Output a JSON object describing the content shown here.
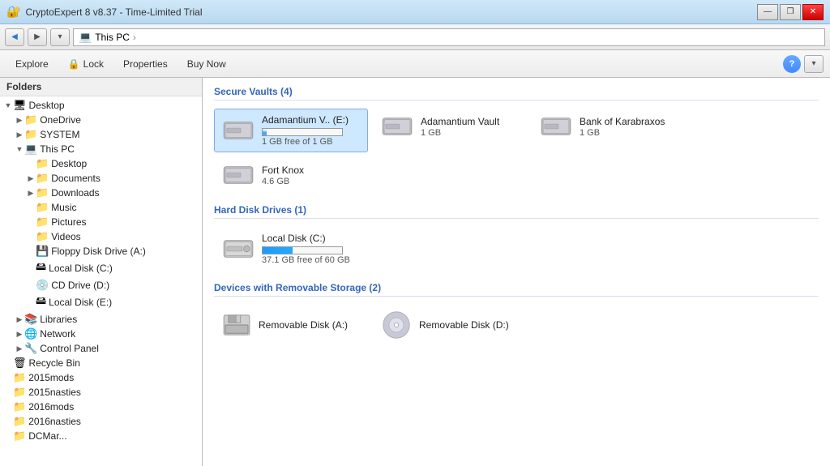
{
  "window": {
    "title": "CryptoExpert 8 v8.37 - Time-Limited Trial",
    "title_icon": "🔐"
  },
  "titlebar": {
    "minimize_label": "—",
    "restore_label": "❐",
    "close_label": "✕"
  },
  "addressbar": {
    "back_icon": "◀",
    "forward_icon": "▶",
    "dropdown_icon": "▾",
    "path_label": "This PC",
    "path_sep": "›",
    "pc_icon": "💻"
  },
  "toolbar": {
    "explore_label": "Explore",
    "lock_label": "Lock",
    "lock_icon": "🔒",
    "properties_label": "Properties",
    "buynow_label": "Buy Now",
    "help_label": "?",
    "dropdown_label": "▾"
  },
  "sidebar": {
    "header": "Folders",
    "items": [
      {
        "label": "Desktop",
        "icon": "🖥",
        "indent": 0,
        "expand": "▼",
        "type": "desktop"
      },
      {
        "label": "OneDrive",
        "icon": "📁",
        "indent": 1,
        "expand": "▶",
        "type": "folder"
      },
      {
        "label": "SYSTEM",
        "icon": "📁",
        "indent": 1,
        "expand": "▶",
        "type": "folder"
      },
      {
        "label": "This PC",
        "icon": "💻",
        "indent": 1,
        "expand": "▼",
        "type": "pc"
      },
      {
        "label": "Desktop",
        "icon": "📁",
        "indent": 2,
        "expand": "",
        "type": "folder"
      },
      {
        "label": "Documents",
        "icon": "📁",
        "indent": 2,
        "expand": "▶",
        "type": "folder"
      },
      {
        "label": "Downloads",
        "icon": "📁",
        "indent": 2,
        "expand": "▶",
        "type": "folder"
      },
      {
        "label": "Music",
        "icon": "📁",
        "indent": 2,
        "expand": "",
        "type": "folder"
      },
      {
        "label": "Pictures",
        "icon": "📁",
        "indent": 2,
        "expand": "",
        "type": "folder"
      },
      {
        "label": "Videos",
        "icon": "📁",
        "indent": 2,
        "expand": "",
        "type": "folder"
      },
      {
        "label": "Floppy Disk Drive (A:)",
        "icon": "💾",
        "indent": 2,
        "expand": "",
        "type": "drive"
      },
      {
        "label": "Local Disk (C:)",
        "icon": "🖴",
        "indent": 2,
        "expand": "",
        "type": "drive"
      },
      {
        "label": "CD Drive (D:)",
        "icon": "💿",
        "indent": 2,
        "expand": "",
        "type": "drive"
      },
      {
        "label": "Local Disk (E:)",
        "icon": "🖴",
        "indent": 2,
        "expand": "",
        "type": "drive"
      },
      {
        "label": "Libraries",
        "icon": "📚",
        "indent": 1,
        "expand": "▶",
        "type": "folder"
      },
      {
        "label": "Network",
        "icon": "🌐",
        "indent": 1,
        "expand": "▶",
        "type": "network"
      },
      {
        "label": "Control Panel",
        "icon": "🔧",
        "indent": 1,
        "expand": "▶",
        "type": "folder"
      },
      {
        "label": "Recycle Bin",
        "icon": "🗑",
        "indent": 0,
        "expand": "",
        "type": "recycle"
      },
      {
        "label": "2015mods",
        "icon": "📁",
        "indent": 0,
        "expand": "",
        "type": "folder"
      },
      {
        "label": "2015nasties",
        "icon": "📁",
        "indent": 0,
        "expand": "",
        "type": "folder"
      },
      {
        "label": "2016mods",
        "icon": "📁",
        "indent": 0,
        "expand": "",
        "type": "folder"
      },
      {
        "label": "2016nasties",
        "icon": "📁",
        "indent": 0,
        "expand": "",
        "type": "folder"
      },
      {
        "label": "DCMar...",
        "icon": "📁",
        "indent": 0,
        "expand": "",
        "type": "folder"
      }
    ]
  },
  "main": {
    "secure_vaults_header": "Secure Vaults (4)",
    "hard_disk_header": "Hard Disk Drives (1)",
    "removable_header": "Devices with Removable Storage (2)",
    "vaults": [
      {
        "name": "Adamantium V.. (E:)",
        "size": "1 GB free of 1 GB",
        "selected": true,
        "progress": 5
      },
      {
        "name": "Adamantium Vault",
        "size": "1 GB",
        "selected": false,
        "progress": 0
      },
      {
        "name": "Bank of Karabraxos",
        "size": "1 GB",
        "selected": false,
        "progress": 0
      },
      {
        "name": "Fort Knox",
        "size": "4.6 GB",
        "selected": false,
        "progress": 0
      }
    ],
    "hard_disks": [
      {
        "name": "Local Disk (C:)",
        "size": "37.1 GB free of 60 GB",
        "progress": 38
      }
    ],
    "removable": [
      {
        "name": "Removable Disk (A:)",
        "type": "floppy"
      },
      {
        "name": "Removable Disk (D:)",
        "type": "cd"
      }
    ]
  }
}
